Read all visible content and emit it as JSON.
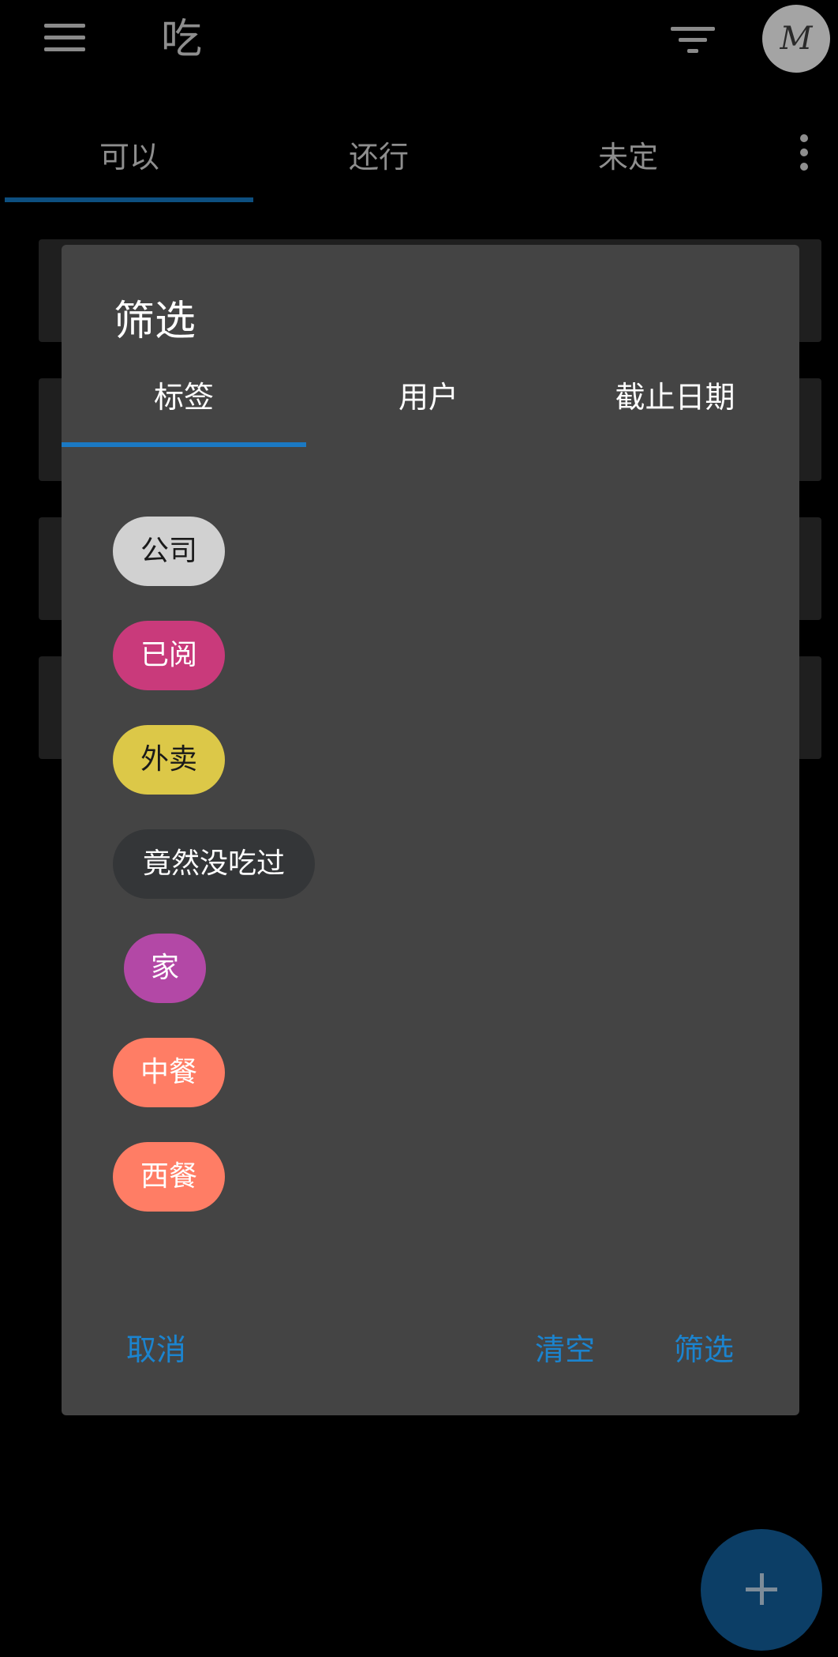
{
  "app_title": "吃",
  "avatar_initial": "M",
  "main_tabs": [
    {
      "label": "可以"
    },
    {
      "label": "还行"
    },
    {
      "label": "未定"
    }
  ],
  "dialog": {
    "title": "筛选",
    "tabs": [
      {
        "label": "标签"
      },
      {
        "label": "用户"
      },
      {
        "label": "截止日期"
      }
    ],
    "tags": [
      {
        "label": "公司",
        "bg": "#d1d1d1",
        "fg": "#1a1a1a"
      },
      {
        "label": "已阅",
        "bg": "#c93a7b",
        "fg": "#ffffff"
      },
      {
        "label": "外卖",
        "bg": "#dcc848",
        "fg": "#1a1a1a"
      },
      {
        "label": "竟然没吃过",
        "bg": "#343638",
        "fg": "#ffffff"
      },
      {
        "label": "家",
        "bg": "#b348a6",
        "fg": "#ffffff"
      },
      {
        "label": "中餐",
        "bg": "#ff7d65",
        "fg": "#ffffff"
      },
      {
        "label": "西餐",
        "bg": "#ff7d65",
        "fg": "#ffffff"
      }
    ],
    "cancel_label": "取消",
    "clear_label": "清空",
    "apply_label": "筛选"
  },
  "colors": {
    "accent": "#1b84cf",
    "dialog_bg": "#444444",
    "fab": "#0c3e66"
  }
}
